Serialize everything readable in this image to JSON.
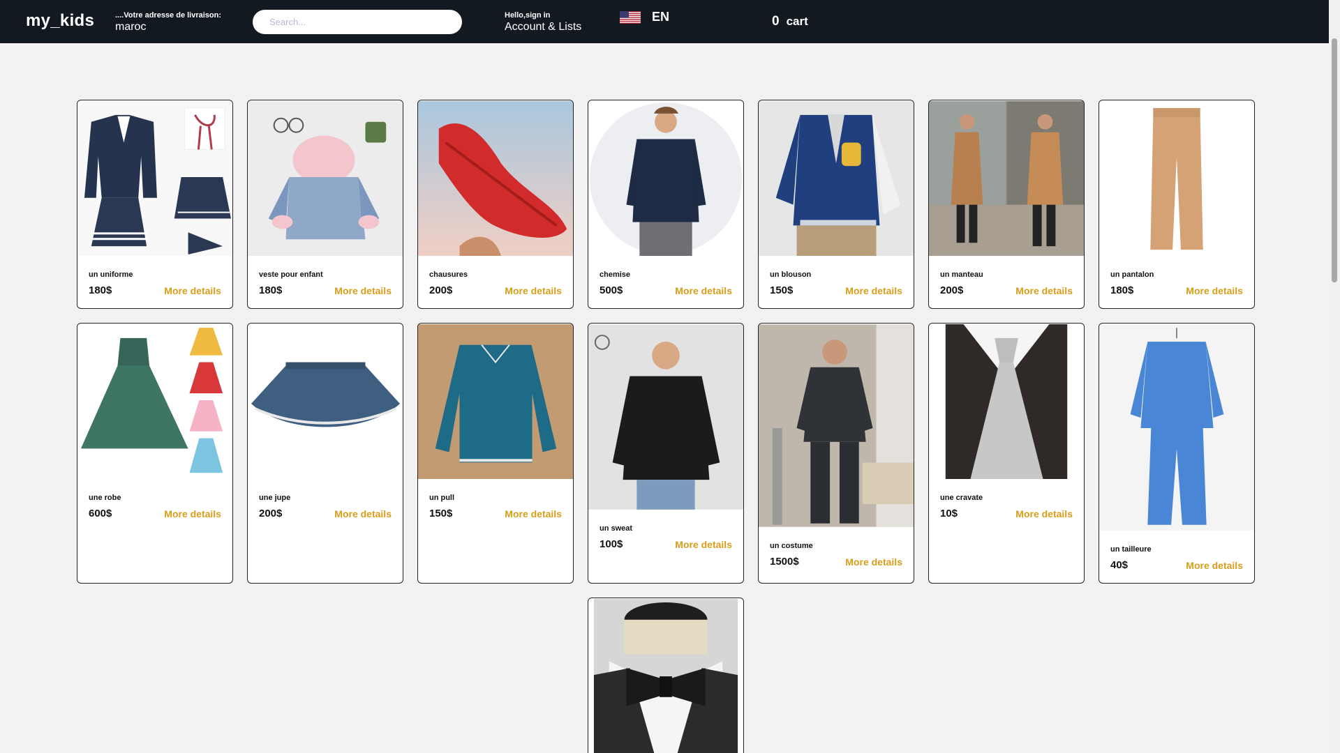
{
  "header": {
    "logo": "my_kids",
    "address_label": "....Votre adresse de livraison:",
    "address_value": "maroc",
    "search_placeholder": "Search...",
    "greeting": "Hello,sign in",
    "account_lists": "Account & Lists",
    "language": "EN",
    "flag_icon": "us-flag-icon",
    "cart_count": "0",
    "cart_label": "cart"
  },
  "products": [
    {
      "name": "un uniforme",
      "price": "180$",
      "more": "More details"
    },
    {
      "name": "veste pour enfant",
      "price": "180$",
      "more": "More details"
    },
    {
      "name": "chausures",
      "price": "200$",
      "more": "More details"
    },
    {
      "name": "chemise",
      "price": "500$",
      "more": "More details"
    },
    {
      "name": "un blouson",
      "price": "150$",
      "more": "More details"
    },
    {
      "name": "un manteau",
      "price": "200$",
      "more": "More details"
    },
    {
      "name": "un pantalon",
      "price": "180$",
      "more": "More details"
    },
    {
      "name": "une robe",
      "price": "600$",
      "more": "More details"
    },
    {
      "name": "une jupe",
      "price": "200$",
      "more": "More details"
    },
    {
      "name": "un pull",
      "price": "150$",
      "more": "More details"
    },
    {
      "name": "un sweat",
      "price": "100$",
      "more": "More details"
    },
    {
      "name": "un costume",
      "price": "1500$",
      "more": "More details"
    },
    {
      "name": "une cravate",
      "price": "10$",
      "more": "More details"
    },
    {
      "name": "un tailleure",
      "price": "40$",
      "more": "More details"
    },
    {
      "name": "",
      "price": "",
      "more": ""
    }
  ],
  "colors": {
    "header_bg": "#131921",
    "accent": "#d69e1a",
    "page_bg": "#f2f2f2"
  }
}
